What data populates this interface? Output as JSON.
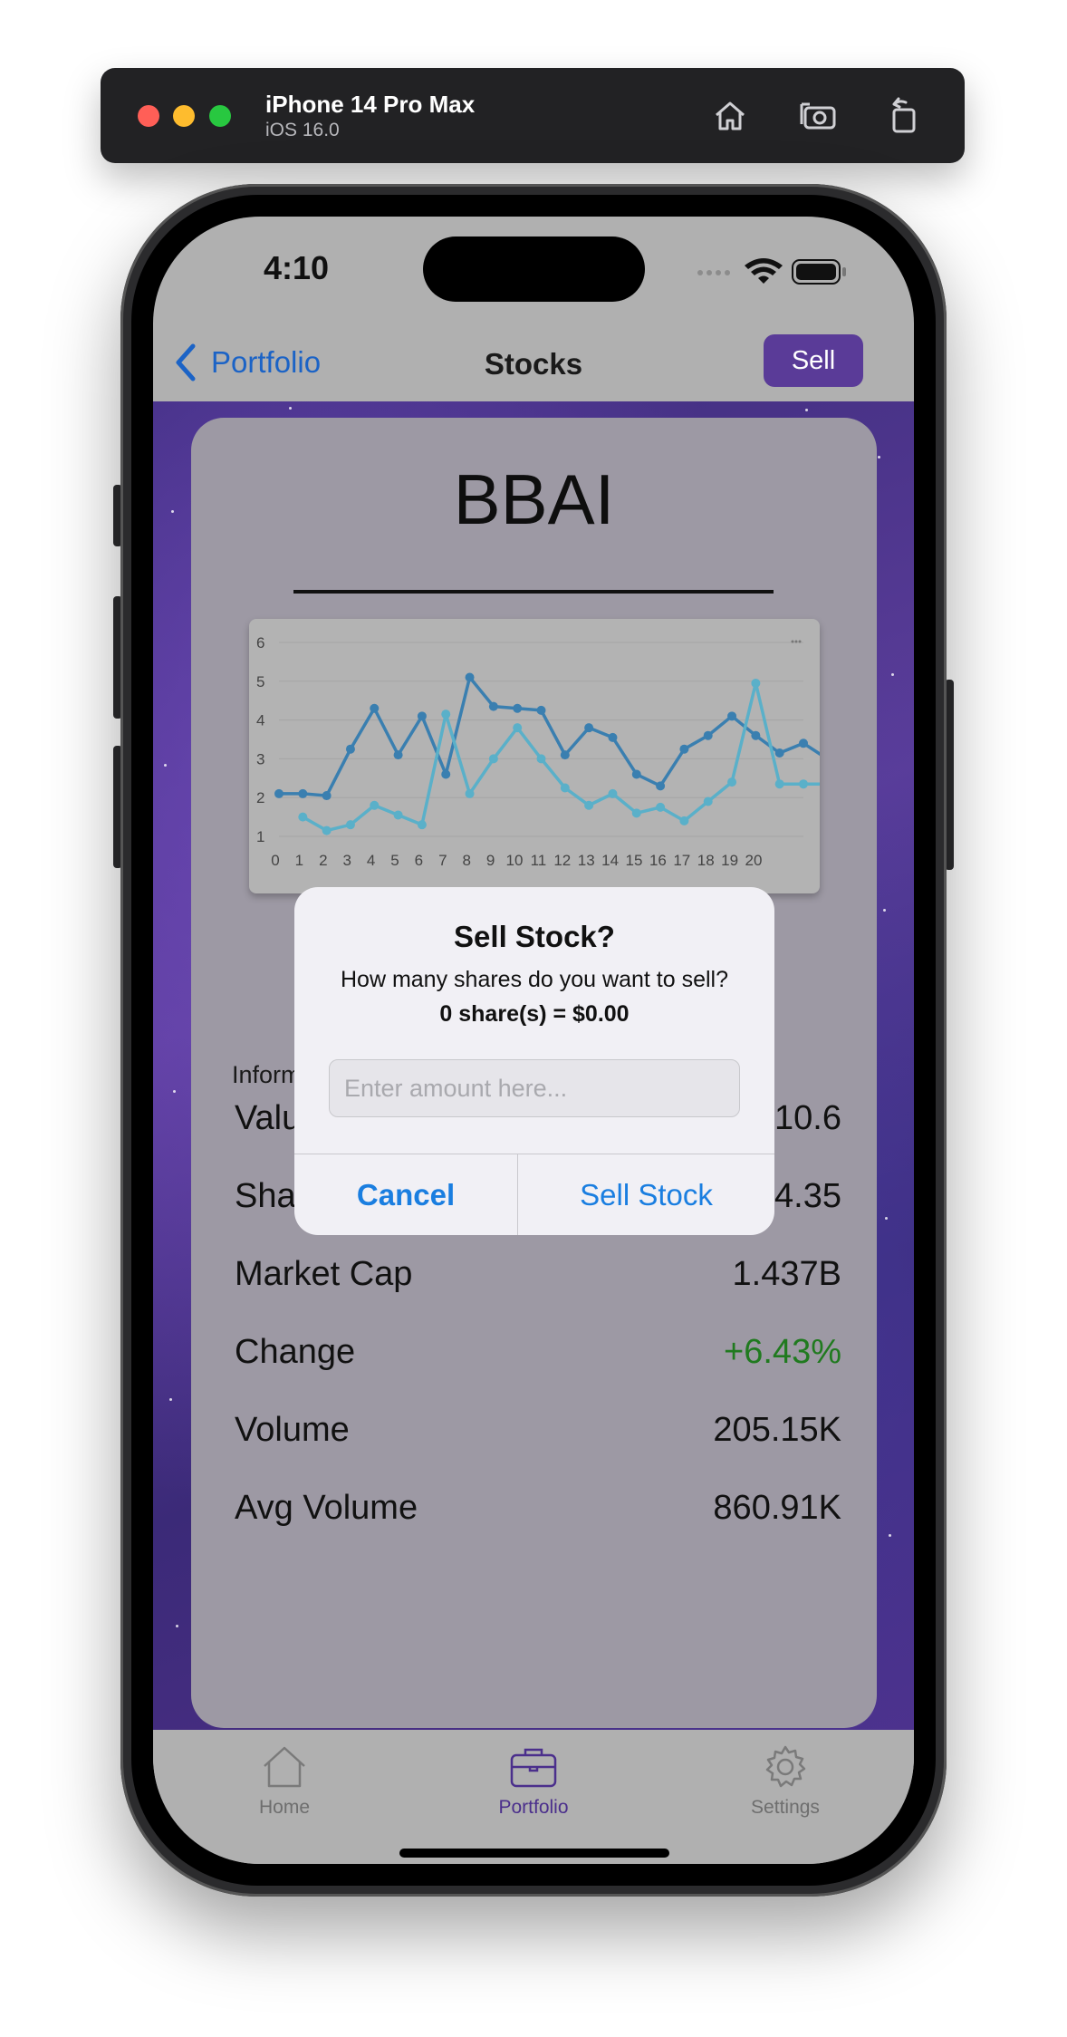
{
  "simulator": {
    "device_name": "iPhone 14 Pro Max",
    "os_version": "iOS 16.0",
    "icons": [
      "home-icon",
      "screenshot-icon",
      "rotate-icon"
    ]
  },
  "status_bar": {
    "time": "4:10"
  },
  "nav": {
    "back_label": "Portfolio",
    "title": "Stocks",
    "sell_label": "Sell"
  },
  "stock": {
    "ticker": "BBAI",
    "info_label": "Information",
    "stats": [
      {
        "key": "Value",
        "value": "10.6"
      },
      {
        "key": "Shares",
        "value": "4.35"
      },
      {
        "key": "Market Cap",
        "value": "1.437B"
      },
      {
        "key": "Change",
        "value": "+6.43%"
      },
      {
        "key": "Volume",
        "value": "205.15K"
      },
      {
        "key": "Avg Volume",
        "value": "860.91K"
      }
    ],
    "change_color": "#207a1f"
  },
  "chart_data": {
    "type": "line",
    "x": [
      0,
      1,
      2,
      3,
      4,
      5,
      6,
      7,
      8,
      9,
      10,
      11,
      12,
      13,
      14,
      15,
      16,
      17,
      18,
      19,
      20
    ],
    "ylim": [
      1,
      6
    ],
    "y_ticks": [
      1,
      2,
      3,
      4,
      5,
      6
    ],
    "grid": true,
    "series": [
      {
        "color": "#3a7fb0",
        "values": [
          2.1,
          2.1,
          2.05,
          3.25,
          4.3,
          3.1,
          4.1,
          2.6,
          5.1,
          4.35,
          4.3,
          4.25,
          3.1,
          3.8,
          3.55,
          2.6,
          2.3,
          3.25,
          3.6,
          4.1,
          3.6,
          3.15,
          3.4,
          3.0
        ]
      },
      {
        "color": "#5ab0c9",
        "values": [
          null,
          1.5,
          1.15,
          1.3,
          1.8,
          1.55,
          1.3,
          4.15,
          2.1,
          3.0,
          3.8,
          3.0,
          2.25,
          1.8,
          2.1,
          1.6,
          1.75,
          1.4,
          1.9,
          2.4,
          4.95,
          2.35,
          2.35,
          2.35
        ]
      }
    ]
  },
  "alert": {
    "title": "Sell Stock?",
    "message": "How many shares do you want to sell?",
    "total": "0 share(s) = $0.00",
    "input_placeholder": "Enter amount here...",
    "cancel_label": "Cancel",
    "confirm_label": "Sell Stock"
  },
  "tabs": [
    {
      "label": "Home",
      "icon": "home-icon",
      "active": false
    },
    {
      "label": "Portfolio",
      "icon": "briefcase-icon",
      "active": true
    },
    {
      "label": "Settings",
      "icon": "gear-icon",
      "active": false
    }
  ]
}
